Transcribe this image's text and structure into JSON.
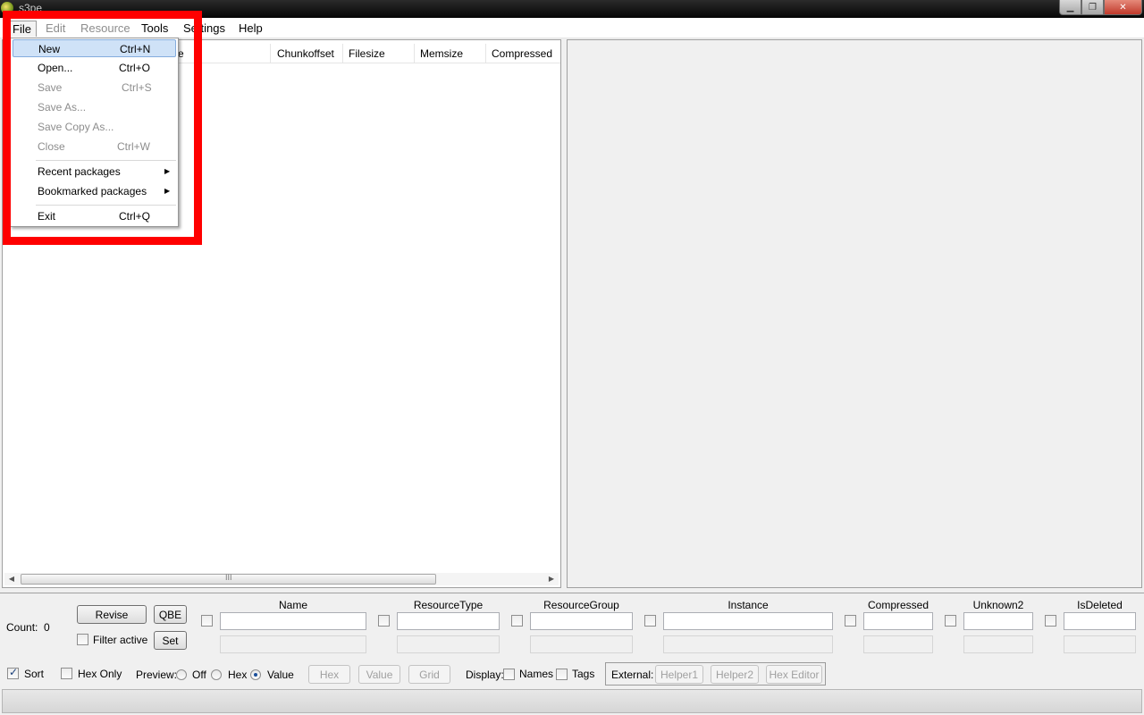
{
  "window": {
    "title": "s3pe"
  },
  "menubar": {
    "file": "File",
    "edit": "Edit",
    "resource": "Resource",
    "tools": "Tools",
    "settings": "Settings",
    "help": "Help"
  },
  "file_menu": {
    "new": {
      "label": "New",
      "shortcut": "Ctrl+N"
    },
    "open": {
      "label": "Open...",
      "shortcut": "Ctrl+O"
    },
    "save": {
      "label": "Save",
      "shortcut": "Ctrl+S"
    },
    "save_as": {
      "label": "Save As..."
    },
    "save_copy_as": {
      "label": "Save Copy As..."
    },
    "close": {
      "label": "Close",
      "shortcut": "Ctrl+W"
    },
    "recent": {
      "label": "Recent packages"
    },
    "bookmarked": {
      "label": "Bookmarked packages"
    },
    "exit": {
      "label": "Exit",
      "shortcut": "Ctrl+Q"
    }
  },
  "list": {
    "columns": [
      "ce",
      "Chunkoffset",
      "Filesize",
      "Memsize",
      "Compressed"
    ],
    "scroll_grip": "III"
  },
  "bottom": {
    "count_label": "Count:",
    "count_value": "0",
    "revise": "Revise",
    "qbe": "QBE",
    "filter_active": "Filter active",
    "set": "Set",
    "filter_columns": [
      "Name",
      "ResourceType",
      "ResourceGroup",
      "Instance",
      "Compressed",
      "Unknown2",
      "IsDeleted"
    ],
    "sort": "Sort",
    "hex_only": "Hex Only",
    "preview_label": "Preview:",
    "preview_off": "Off",
    "preview_hex": "Hex",
    "preview_value": "Value",
    "btn_hex": "Hex",
    "btn_value": "Value",
    "btn_grid": "Grid",
    "display_label": "Display:",
    "display_names": "Names",
    "display_tags": "Tags",
    "external_label": "External:",
    "helper1": "Helper1",
    "helper2": "Helper2",
    "hex_editor": "Hex Editor"
  }
}
